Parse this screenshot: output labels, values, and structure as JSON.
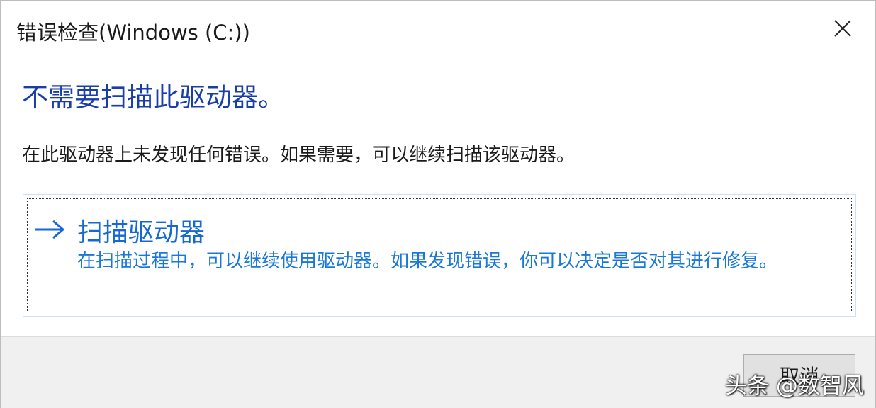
{
  "window": {
    "title": "错误检查(Windows (C:))"
  },
  "main": {
    "heading": "不需要扫描此驱动器。",
    "description": "在此驱动器上未发现任何错误。如果需要，可以继续扫描该驱动器。"
  },
  "scan_option": {
    "icon": "arrow-right-icon",
    "title": "扫描驱动器",
    "detail": "在扫描过程中，可以继续使用驱动器。如果发现错误，你可以决定是否对其进行修复。"
  },
  "footer": {
    "cancel_label": "取消"
  },
  "watermark": {
    "text": "头条 @数智风"
  },
  "colors": {
    "heading": "#1a3ea8",
    "link": "#1668d3",
    "footer_bg": "#f0f0f0"
  }
}
